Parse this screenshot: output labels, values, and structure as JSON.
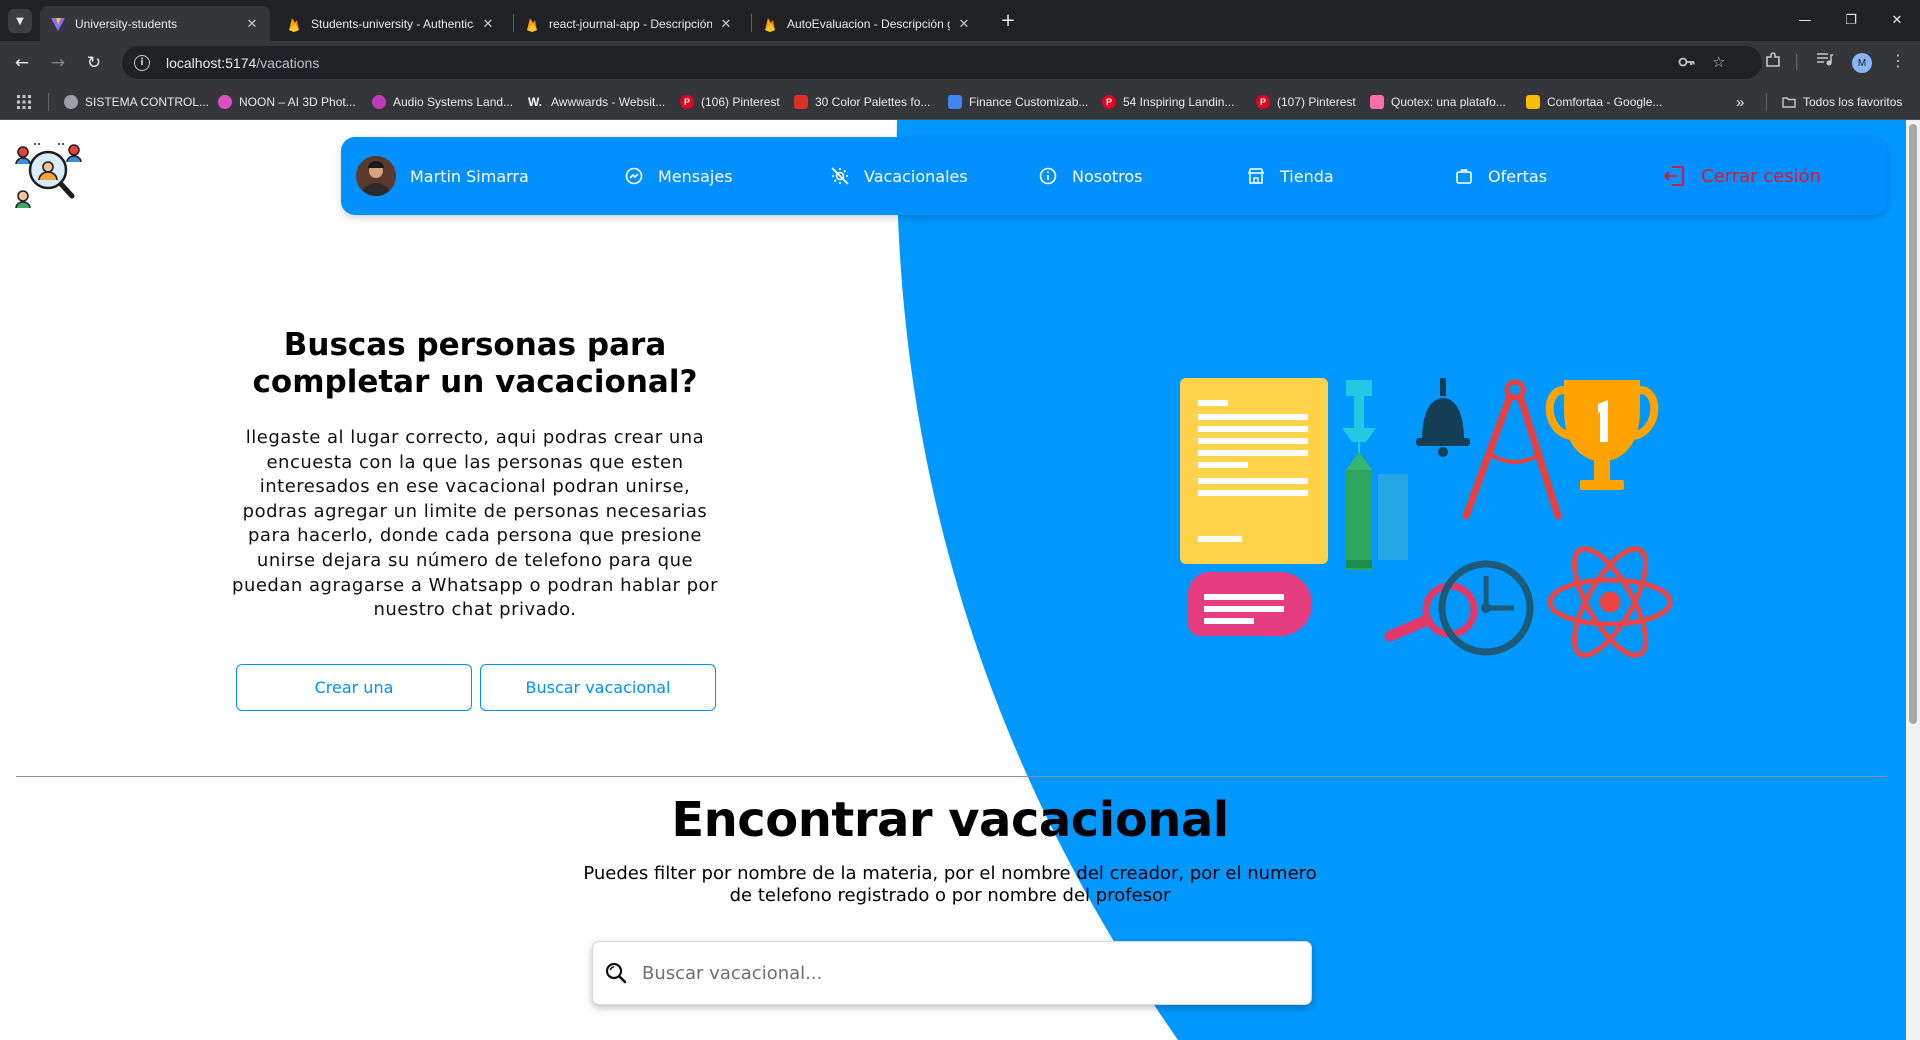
{
  "browser": {
    "tabs": [
      {
        "title": "University-students",
        "active": true
      },
      {
        "title": "Students-university - Authentica"
      },
      {
        "title": "react-journal-app - Descripción g"
      },
      {
        "title": "AutoEvaluacion - Descripción g"
      }
    ],
    "url_host": "localhost:5174",
    "url_path": "/vacations",
    "profile_initial": "M",
    "bookmarks": [
      {
        "label": "SISTEMA CONTROL...",
        "color": "#9aa0a6"
      },
      {
        "label": "NOON – AI 3D Phot...",
        "color": "#d94fc4"
      },
      {
        "label": "Audio Systems Land...",
        "color": "#c13bb8"
      },
      {
        "label": "Awwwards - Websit...",
        "glyph": "W.",
        "color": "#35363a"
      },
      {
        "label": "(106) Pinterest",
        "glyph": "P",
        "color": "#e60023"
      },
      {
        "label": "30 Color Palettes fo...",
        "color": "#d93025"
      },
      {
        "label": "Finance Customizab...",
        "color": "#4285f4"
      },
      {
        "label": "54 Inspiring Landin...",
        "glyph": "P",
        "color": "#e60023"
      },
      {
        "label": "(107) Pinterest",
        "glyph": "P",
        "color": "#e60023"
      },
      {
        "label": "Quotex: una platafo...",
        "color": "#ff6fa5"
      },
      {
        "label": "Comfortaa - Google...",
        "color": "#fbbc04"
      }
    ],
    "bookmarks_overflow": "»",
    "all_bookmarks": "Todos los favoritos"
  },
  "navbar": {
    "user_name": "Martin Simarra",
    "items": [
      {
        "label": "Mensajes",
        "icon": "messenger-icon"
      },
      {
        "label": "Vacacionales",
        "icon": "no-sun-icon"
      },
      {
        "label": "Nosotros",
        "icon": "info-icon"
      },
      {
        "label": "Tienda",
        "icon": "store-icon"
      },
      {
        "label": "Ofertas",
        "icon": "briefcase-icon"
      }
    ],
    "logout": "Cerrar cesión"
  },
  "hero": {
    "title": "Buscas personas para completar un vacacional?",
    "description": "llegaste al lugar correcto, aqui podras crear una encuesta con la que las personas que esten interesados en ese vacacional podran unirse, podras agregar un limite de personas necesarias para hacerlo, donde cada persona que presione unirse dejara su número de telefono para que puedan agragarse a Whatsapp o podran hablar por nuestro chat privado.",
    "btn_create": "Crear una",
    "btn_search": "Buscar vacacional"
  },
  "find": {
    "title": "Encontrar vacacional",
    "subtitle": "Puedes filter por nombre de la materia, por el nombre del creador, por el numero de telefono registrado o por nombre del profesor",
    "search_placeholder": "Buscar vacacional..."
  },
  "colors": {
    "primary": "#0090ff",
    "logout": "#e0152e"
  }
}
